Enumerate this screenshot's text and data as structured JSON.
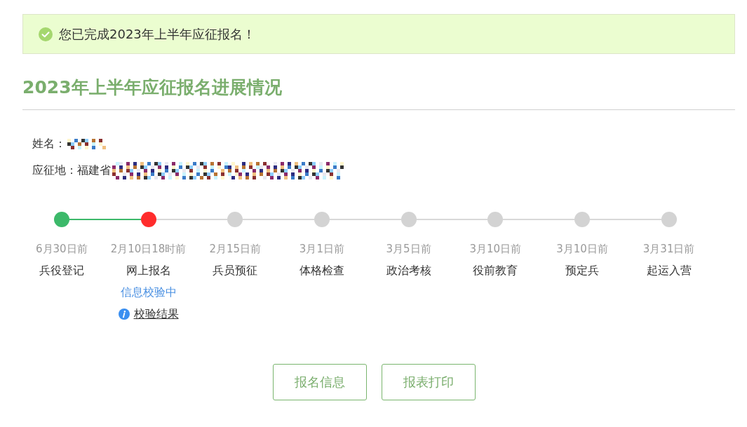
{
  "notice": {
    "text": "您已完成2023年上半年应征报名！"
  },
  "title": "2023年上半年应征报名进展情况",
  "applicant": {
    "name_label": "姓名：",
    "name_redacted": true,
    "region_label": "应征地：",
    "region_value": "福建省",
    "region_redacted": true
  },
  "steps": [
    {
      "date": "6月30日前",
      "name": "兵役登记",
      "color": "#3cb96a",
      "completed": true
    },
    {
      "date": "2月10日18时前",
      "name": "网上报名",
      "color": "#ff2c2c",
      "completed": false,
      "status": "信息校验中",
      "link": "校验结果"
    },
    {
      "date": "2月15日前",
      "name": "兵员预征",
      "color": "#d3d3d3",
      "completed": false
    },
    {
      "date": "3月1日前",
      "name": "体格检查",
      "color": "#d3d3d3",
      "completed": false
    },
    {
      "date": "3月5日前",
      "name": "政治考核",
      "color": "#d3d3d3",
      "completed": false
    },
    {
      "date": "3月10日前",
      "name": "役前教育",
      "color": "#d3d3d3",
      "completed": false
    },
    {
      "date": "3月10日前",
      "name": "预定兵",
      "color": "#d3d3d3",
      "completed": false
    },
    {
      "date": "3月31日前",
      "name": "起运入营",
      "color": "#d3d3d3",
      "completed": false
    }
  ],
  "buttons": [
    "报名信息",
    "报表打印"
  ]
}
